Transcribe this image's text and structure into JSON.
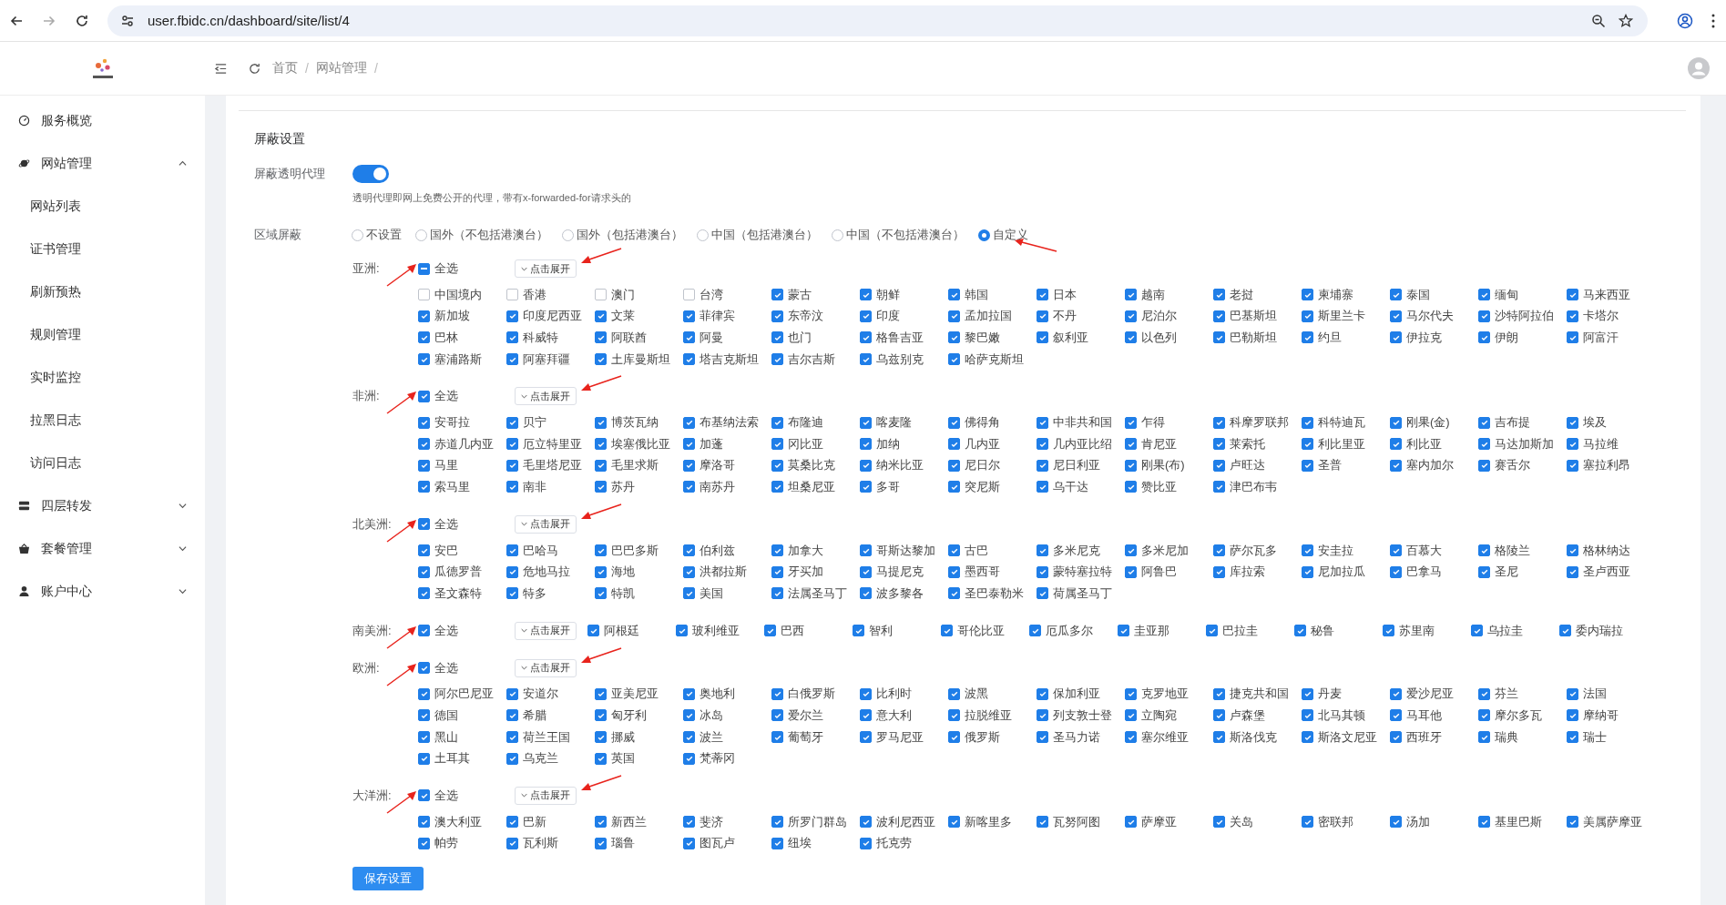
{
  "browser": {
    "url": "user.fbidc.cn/dashboard/site/list/4"
  },
  "header": {
    "breadcrumbs": [
      {
        "label": "首页",
        "separator": "/"
      },
      {
        "label": "网站管理",
        "separator": "/"
      }
    ]
  },
  "sidebar": {
    "items": [
      {
        "label": "服务概览",
        "kind": "link"
      },
      {
        "label": "网站管理",
        "kind": "group",
        "expanded": true,
        "children": [
          {
            "label": "网站列表"
          },
          {
            "label": "证书管理"
          },
          {
            "label": "刷新预热"
          },
          {
            "label": "规则管理"
          },
          {
            "label": "实时监控"
          },
          {
            "label": "拉黑日志"
          },
          {
            "label": "访问日志"
          }
        ]
      },
      {
        "label": "四层转发",
        "kind": "group",
        "expanded": false
      },
      {
        "label": "套餐管理",
        "kind": "group",
        "expanded": false
      },
      {
        "label": "账户中心",
        "kind": "group",
        "expanded": false
      }
    ]
  },
  "section_title": "屏蔽设置",
  "proxy_toggle": {
    "label": "屏蔽透明代理",
    "on": true,
    "hint": "透明代理即网上免费公开的代理，带有x-forwarded-for请求头的"
  },
  "region_block": {
    "label": "区域屏蔽",
    "options": [
      {
        "label": "不设置",
        "selected": false
      },
      {
        "label": "国外（不包括港澳台）",
        "selected": false
      },
      {
        "label": "国外（包括港澳台）",
        "selected": false
      },
      {
        "label": "中国（包括港澳台）",
        "selected": false
      },
      {
        "label": "中国（不包括港澳台）",
        "selected": false
      },
      {
        "label": "自定义",
        "selected": true
      }
    ]
  },
  "continents": [
    {
      "name": "亚洲:",
      "kind": "grid",
      "select_all": {
        "label": "全选",
        "checked": false,
        "indeterminate": true
      },
      "expand_button": "点击展开",
      "countries": [
        {
          "label": "中国境内",
          "checked": false
        },
        {
          "label": "香港",
          "checked": false
        },
        {
          "label": "澳门",
          "checked": false
        },
        {
          "label": "台湾",
          "checked": false
        },
        {
          "label": "蒙古",
          "checked": true
        },
        {
          "label": "朝鲜",
          "checked": true
        },
        {
          "label": "韩国",
          "checked": true
        },
        {
          "label": "日本",
          "checked": true
        },
        {
          "label": "越南",
          "checked": true
        },
        {
          "label": "老挝",
          "checked": true
        },
        {
          "label": "柬埔寨",
          "checked": true
        },
        {
          "label": "泰国",
          "checked": true
        },
        {
          "label": "缅甸",
          "checked": true
        },
        {
          "label": "马来西亚",
          "checked": true
        },
        {
          "label": "新加坡",
          "checked": true
        },
        {
          "label": "印度尼西亚",
          "checked": true
        },
        {
          "label": "文莱",
          "checked": true
        },
        {
          "label": "菲律宾",
          "checked": true
        },
        {
          "label": "东帝汶",
          "checked": true
        },
        {
          "label": "印度",
          "checked": true
        },
        {
          "label": "孟加拉国",
          "checked": true
        },
        {
          "label": "不丹",
          "checked": true
        },
        {
          "label": "尼泊尔",
          "checked": true
        },
        {
          "label": "巴基斯坦",
          "checked": true
        },
        {
          "label": "斯里兰卡",
          "checked": true
        },
        {
          "label": "马尔代夫",
          "checked": true
        },
        {
          "label": "沙特阿拉伯",
          "checked": true
        },
        {
          "label": "卡塔尔",
          "checked": true
        },
        {
          "label": "巴林",
          "checked": true
        },
        {
          "label": "科威特",
          "checked": true
        },
        {
          "label": "阿联酋",
          "checked": true
        },
        {
          "label": "阿曼",
          "checked": true
        },
        {
          "label": "也门",
          "checked": true
        },
        {
          "label": "格鲁吉亚",
          "checked": true
        },
        {
          "label": "黎巴嫩",
          "checked": true
        },
        {
          "label": "叙利亚",
          "checked": true
        },
        {
          "label": "以色列",
          "checked": true
        },
        {
          "label": "巴勒斯坦",
          "checked": true
        },
        {
          "label": "约旦",
          "checked": true
        },
        {
          "label": "伊拉克",
          "checked": true
        },
        {
          "label": "伊朗",
          "checked": true
        },
        {
          "label": "阿富汗",
          "checked": true
        },
        {
          "label": "塞浦路斯",
          "checked": true
        },
        {
          "label": "阿塞拜疆",
          "checked": true
        },
        {
          "label": "土库曼斯坦",
          "checked": true
        },
        {
          "label": "塔吉克斯坦",
          "checked": true
        },
        {
          "label": "吉尔吉斯",
          "checked": true
        },
        {
          "label": "乌兹别克",
          "checked": true
        },
        {
          "label": "哈萨克斯坦",
          "checked": true
        }
      ]
    },
    {
      "name": "非洲:",
      "kind": "grid",
      "select_all": {
        "label": "全选",
        "checked": true,
        "indeterminate": false
      },
      "expand_button": "点击展开",
      "countries": [
        {
          "label": "安哥拉",
          "checked": true
        },
        {
          "label": "贝宁",
          "checked": true
        },
        {
          "label": "博茨瓦纳",
          "checked": true
        },
        {
          "label": "布基纳法索",
          "checked": true
        },
        {
          "label": "布隆迪",
          "checked": true
        },
        {
          "label": "喀麦隆",
          "checked": true
        },
        {
          "label": "佛得角",
          "checked": true
        },
        {
          "label": "中非共和国",
          "checked": true
        },
        {
          "label": "乍得",
          "checked": true
        },
        {
          "label": "科摩罗联邦",
          "checked": true
        },
        {
          "label": "科特迪瓦",
          "checked": true
        },
        {
          "label": "刚果(金)",
          "checked": true
        },
        {
          "label": "吉布提",
          "checked": true
        },
        {
          "label": "埃及",
          "checked": true
        },
        {
          "label": "赤道几内亚",
          "checked": true
        },
        {
          "label": "厄立特里亚",
          "checked": true
        },
        {
          "label": "埃塞俄比亚",
          "checked": true
        },
        {
          "label": "加蓬",
          "checked": true
        },
        {
          "label": "冈比亚",
          "checked": true
        },
        {
          "label": "加纳",
          "checked": true
        },
        {
          "label": "几内亚",
          "checked": true
        },
        {
          "label": "几内亚比绍",
          "checked": true
        },
        {
          "label": "肯尼亚",
          "checked": true
        },
        {
          "label": "莱索托",
          "checked": true
        },
        {
          "label": "利比里亚",
          "checked": true
        },
        {
          "label": "利比亚",
          "checked": true
        },
        {
          "label": "马达加斯加",
          "checked": true
        },
        {
          "label": "马拉维",
          "checked": true
        },
        {
          "label": "马里",
          "checked": true
        },
        {
          "label": "毛里塔尼亚",
          "checked": true
        },
        {
          "label": "毛里求斯",
          "checked": true
        },
        {
          "label": "摩洛哥",
          "checked": true
        },
        {
          "label": "莫桑比克",
          "checked": true
        },
        {
          "label": "纳米比亚",
          "checked": true
        },
        {
          "label": "尼日尔",
          "checked": true
        },
        {
          "label": "尼日利亚",
          "checked": true
        },
        {
          "label": "刚果(布)",
          "checked": true
        },
        {
          "label": "卢旺达",
          "checked": true
        },
        {
          "label": "圣普",
          "checked": true
        },
        {
          "label": "塞内加尔",
          "checked": true
        },
        {
          "label": "赛舌尔",
          "checked": true
        },
        {
          "label": "塞拉利昂",
          "checked": true
        },
        {
          "label": "索马里",
          "checked": true
        },
        {
          "label": "南非",
          "checked": true
        },
        {
          "label": "苏丹",
          "checked": true
        },
        {
          "label": "南苏丹",
          "checked": true
        },
        {
          "label": "坦桑尼亚",
          "checked": true
        },
        {
          "label": "多哥",
          "checked": true
        },
        {
          "label": "突尼斯",
          "checked": true
        },
        {
          "label": "乌干达",
          "checked": true
        },
        {
          "label": "赞比亚",
          "checked": true
        },
        {
          "label": "津巴布韦",
          "checked": true
        }
      ]
    },
    {
      "name": "北美洲:",
      "kind": "grid",
      "select_all": {
        "label": "全选",
        "checked": true,
        "indeterminate": false
      },
      "expand_button": "点击展开",
      "countries": [
        {
          "label": "安巴",
          "checked": true
        },
        {
          "label": "巴哈马",
          "checked": true
        },
        {
          "label": "巴巴多斯",
          "checked": true
        },
        {
          "label": "伯利兹",
          "checked": true
        },
        {
          "label": "加拿大",
          "checked": true
        },
        {
          "label": "哥斯达黎加",
          "checked": true
        },
        {
          "label": "古巴",
          "checked": true
        },
        {
          "label": "多米尼克",
          "checked": true
        },
        {
          "label": "多米尼加",
          "checked": true
        },
        {
          "label": "萨尔瓦多",
          "checked": true
        },
        {
          "label": "安圭拉",
          "checked": true
        },
        {
          "label": "百慕大",
          "checked": true
        },
        {
          "label": "格陵兰",
          "checked": true
        },
        {
          "label": "格林纳达",
          "checked": true
        },
        {
          "label": "瓜德罗普",
          "checked": true
        },
        {
          "label": "危地马拉",
          "checked": true
        },
        {
          "label": "海地",
          "checked": true
        },
        {
          "label": "洪都拉斯",
          "checked": true
        },
        {
          "label": "牙买加",
          "checked": true
        },
        {
          "label": "马提尼克",
          "checked": true
        },
        {
          "label": "墨西哥",
          "checked": true
        },
        {
          "label": "蒙特塞拉特",
          "checked": true
        },
        {
          "label": "阿鲁巴",
          "checked": true
        },
        {
          "label": "库拉索",
          "checked": true
        },
        {
          "label": "尼加拉瓜",
          "checked": true
        },
        {
          "label": "巴拿马",
          "checked": true
        },
        {
          "label": "圣尼",
          "checked": true
        },
        {
          "label": "圣卢西亚",
          "checked": true
        },
        {
          "label": "圣文森特",
          "checked": true
        },
        {
          "label": "特多",
          "checked": true
        },
        {
          "label": "特凯",
          "checked": true
        },
        {
          "label": "美国",
          "checked": true
        },
        {
          "label": "法属圣马丁",
          "checked": true
        },
        {
          "label": "波多黎各",
          "checked": true
        },
        {
          "label": "圣巴泰勒米",
          "checked": true
        },
        {
          "label": "荷属圣马丁",
          "checked": true
        }
      ]
    },
    {
      "name": "南美洲:",
      "kind": "inline",
      "select_all": {
        "label": "全选",
        "checked": true,
        "indeterminate": false
      },
      "expand_button": "点击展开",
      "countries": [
        {
          "label": "阿根廷",
          "checked": true
        },
        {
          "label": "玻利维亚",
          "checked": true
        },
        {
          "label": "巴西",
          "checked": true
        },
        {
          "label": "智利",
          "checked": true
        },
        {
          "label": "哥伦比亚",
          "checked": true
        },
        {
          "label": "厄瓜多尔",
          "checked": true
        },
        {
          "label": "圭亚那",
          "checked": true
        },
        {
          "label": "巴拉圭",
          "checked": true
        },
        {
          "label": "秘鲁",
          "checked": true
        },
        {
          "label": "苏里南",
          "checked": true
        },
        {
          "label": "乌拉圭",
          "checked": true
        },
        {
          "label": "委内瑞拉",
          "checked": true
        }
      ]
    },
    {
      "name": "欧洲:",
      "kind": "grid",
      "select_all": {
        "label": "全选",
        "checked": true,
        "indeterminate": false
      },
      "expand_button": "点击展开",
      "countries": [
        {
          "label": "阿尔巴尼亚",
          "checked": true
        },
        {
          "label": "安道尔",
          "checked": true
        },
        {
          "label": "亚美尼亚",
          "checked": true
        },
        {
          "label": "奥地利",
          "checked": true
        },
        {
          "label": "白俄罗斯",
          "checked": true
        },
        {
          "label": "比利时",
          "checked": true
        },
        {
          "label": "波黑",
          "checked": true
        },
        {
          "label": "保加利亚",
          "checked": true
        },
        {
          "label": "克罗地亚",
          "checked": true
        },
        {
          "label": "捷克共和国",
          "checked": true
        },
        {
          "label": "丹麦",
          "checked": true
        },
        {
          "label": "爱沙尼亚",
          "checked": true
        },
        {
          "label": "芬兰",
          "checked": true
        },
        {
          "label": "法国",
          "checked": true
        },
        {
          "label": "德国",
          "checked": true
        },
        {
          "label": "希腊",
          "checked": true
        },
        {
          "label": "匈牙利",
          "checked": true
        },
        {
          "label": "冰岛",
          "checked": true
        },
        {
          "label": "爱尔兰",
          "checked": true
        },
        {
          "label": "意大利",
          "checked": true
        },
        {
          "label": "拉脱维亚",
          "checked": true
        },
        {
          "label": "列支敦士登",
          "checked": true
        },
        {
          "label": "立陶宛",
          "checked": true
        },
        {
          "label": "卢森堡",
          "checked": true
        },
        {
          "label": "北马其顿",
          "checked": true
        },
        {
          "label": "马耳他",
          "checked": true
        },
        {
          "label": "摩尔多瓦",
          "checked": true
        },
        {
          "label": "摩纳哥",
          "checked": true
        },
        {
          "label": "黑山",
          "checked": true
        },
        {
          "label": "荷兰王国",
          "checked": true
        },
        {
          "label": "挪威",
          "checked": true
        },
        {
          "label": "波兰",
          "checked": true
        },
        {
          "label": "葡萄牙",
          "checked": true
        },
        {
          "label": "罗马尼亚",
          "checked": true
        },
        {
          "label": "俄罗斯",
          "checked": true
        },
        {
          "label": "圣马力诺",
          "checked": true
        },
        {
          "label": "塞尔维亚",
          "checked": true
        },
        {
          "label": "斯洛伐克",
          "checked": true
        },
        {
          "label": "斯洛文尼亚",
          "checked": true
        },
        {
          "label": "西班牙",
          "checked": true
        },
        {
          "label": "瑞典",
          "checked": true
        },
        {
          "label": "瑞士",
          "checked": true
        },
        {
          "label": "土耳其",
          "checked": true
        },
        {
          "label": "乌克兰",
          "checked": true
        },
        {
          "label": "英国",
          "checked": true
        },
        {
          "label": "梵蒂冈",
          "checked": true
        }
      ]
    },
    {
      "name": "大洋洲:",
      "kind": "grid",
      "select_all": {
        "label": "全选",
        "checked": true,
        "indeterminate": false
      },
      "expand_button": "点击展开",
      "countries": [
        {
          "label": "澳大利亚",
          "checked": true
        },
        {
          "label": "巴新",
          "checked": true
        },
        {
          "label": "新西兰",
          "checked": true
        },
        {
          "label": "斐济",
          "checked": true
        },
        {
          "label": "所罗门群岛",
          "checked": true
        },
        {
          "label": "波利尼西亚",
          "checked": true
        },
        {
          "label": "新喀里多",
          "checked": true
        },
        {
          "label": "瓦努阿图",
          "checked": true
        },
        {
          "label": "萨摩亚",
          "checked": true
        },
        {
          "label": "关岛",
          "checked": true
        },
        {
          "label": "密联邦",
          "checked": true
        },
        {
          "label": "汤加",
          "checked": true
        },
        {
          "label": "基里巴斯",
          "checked": true
        },
        {
          "label": "美属萨摩亚",
          "checked": true
        },
        {
          "label": "帕劳",
          "checked": true
        },
        {
          "label": "瓦利斯",
          "checked": true
        },
        {
          "label": "瑙鲁",
          "checked": true
        },
        {
          "label": "图瓦卢",
          "checked": true
        },
        {
          "label": "纽埃",
          "checked": true
        },
        {
          "label": "托克劳",
          "checked": true
        }
      ]
    }
  ],
  "save_button": "保存设置"
}
